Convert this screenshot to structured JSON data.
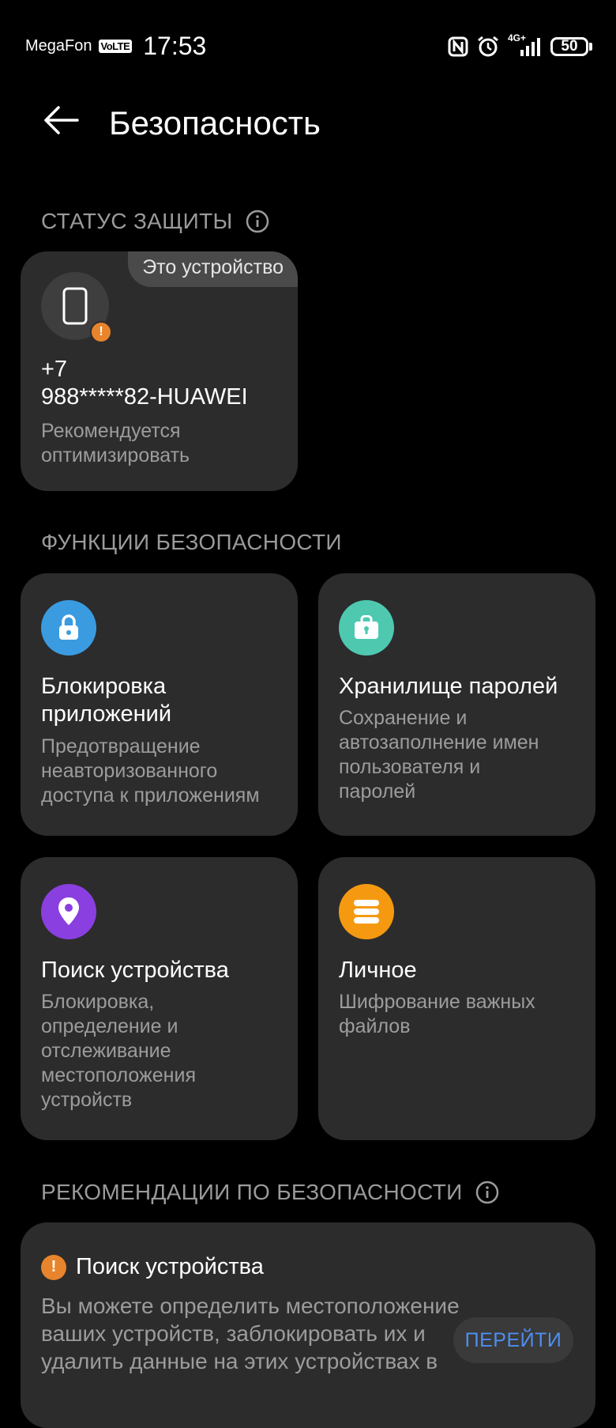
{
  "statusbar": {
    "carrier": "MegaFon",
    "volte": "VoLTE",
    "time": "17:53",
    "network": "4G+",
    "battery": "50",
    "icons": [
      "nfc-icon",
      "alarm-icon",
      "signal-icon",
      "battery-icon"
    ]
  },
  "header": {
    "title": "Безопасность",
    "back_icon": "arrow-left-icon"
  },
  "protection": {
    "label": "СТАТУС ЗАЩИТЫ",
    "device": {
      "tag": "Это устройство",
      "name_line1": "+7",
      "name_line2": "988*****82-HUAWEI",
      "status": "Рекомендуется оптимизировать"
    }
  },
  "features": {
    "label": "ФУНКЦИИ БЕЗОПАСНОСТИ",
    "items": [
      {
        "title": "Блокировка приложений",
        "desc": "Предотвращение неавторизованного доступа к приложениям",
        "icon": "lock-icon",
        "color": "#3a9be0"
      },
      {
        "title": "Хранилище паролей",
        "desc": "Сохранение и автозаполнение имен пользователя и паролей",
        "icon": "password-vault-icon",
        "color": "#4ec9b0"
      },
      {
        "title": "Поиск устройства",
        "desc": "Блокировка, определение и отслеживание местоположения устройств",
        "icon": "location-pin-icon",
        "color": "#8a3fe0"
      },
      {
        "title": "Личное",
        "desc": "Шифрование важных файлов",
        "icon": "safe-storage-icon",
        "color": "#f59a10"
      }
    ]
  },
  "recommendations": {
    "label": "РЕКОМЕНДАЦИИ ПО БЕЗОПАСНОСТИ",
    "item": {
      "title": "Поиск устройства",
      "text": "Вы можете определить местоположение ваших устройств, заблокировать их и удалить данные на этих устройствах в",
      "button": "ПЕРЕЙТИ"
    }
  },
  "colors": {
    "background": "#000000",
    "card": "#2c2c2c",
    "warning": "#e8842c",
    "link": "#4d8ef0"
  }
}
